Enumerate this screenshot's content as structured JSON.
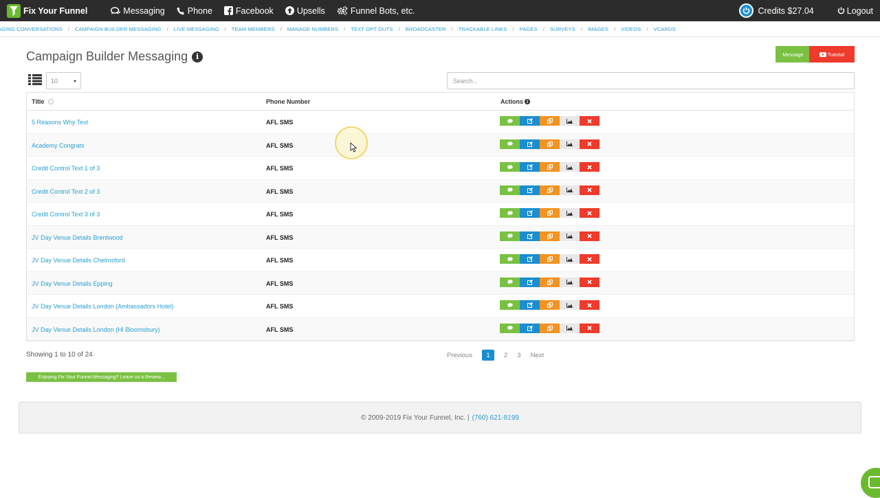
{
  "brand": {
    "name": "Fix Your Funnel"
  },
  "topnav": [
    {
      "label": "Messaging",
      "icon": "comments-icon"
    },
    {
      "label": "Phone",
      "icon": "phone-icon"
    },
    {
      "label": "Facebook",
      "icon": "facebook-icon"
    },
    {
      "label": "Upsells",
      "icon": "arrow-up-circle-icon"
    },
    {
      "label": "Funnel Bots, etc.",
      "icon": "gears-icon"
    }
  ],
  "account": {
    "credits": "Credits $27.04",
    "logout": "Logout"
  },
  "subnav": [
    "AGING CONVERSATIONS",
    "CAMPAIGN BUILDER MESSAGING",
    "LIVE MESSAGING",
    "TEAM MEMBERS",
    "MANAGE NUMBERS",
    "TEXT OPT OUTS",
    "BROADCASTER",
    "TRACKABLE LINKS",
    "PAGES",
    "SURVEYS",
    "IMAGES",
    "VIDEOS",
    "VCARDS"
  ],
  "page": {
    "title": "Campaign Builder Messaging",
    "message_button": "Message",
    "tutorial_button": "Tutorial"
  },
  "controls": {
    "page_size": "10",
    "search_placeholder": "Search..."
  },
  "table": {
    "headers": {
      "title": "Title",
      "phone": "Phone Number",
      "actions": "Actions"
    },
    "rows": [
      {
        "title": "5 Reasons Why Text",
        "phone": "AFL SMS"
      },
      {
        "title": "Academy Congrats",
        "phone": "AFL SMS"
      },
      {
        "title": "Credit Control Text 1 of 3",
        "phone": "AFL SMS"
      },
      {
        "title": "Credit Control Text 2 of 3",
        "phone": "AFL SMS"
      },
      {
        "title": "Credit Control Text 3 of 3",
        "phone": "AFL SMS"
      },
      {
        "title": "JV Day Venue Details Brentwood",
        "phone": "AFL SMS"
      },
      {
        "title": "JV Day Venue Details Chelmsford",
        "phone": "AFL SMS"
      },
      {
        "title": "JV Day Venue Details Epping",
        "phone": "AFL SMS"
      },
      {
        "title": "JV Day Venue Details London (Ambassadors Hotel)",
        "phone": "AFL SMS"
      },
      {
        "title": "JV Day Venue Details London (Hl Bloomsbury)",
        "phone": "AFL SMS"
      }
    ]
  },
  "pagination": {
    "showing": "Showing 1 to 10 of 24",
    "previous": "Previous",
    "pages": [
      "1",
      "2",
      "3"
    ],
    "next": "Next"
  },
  "review_banner": "Enjoying Fix Your Funnel Messaging? Leave us a Review...",
  "footer": {
    "copyright": "© 2009-2019 Fix Your Funnel, Inc. |",
    "phone": "(760) 621-8199"
  },
  "colors": {
    "green": "#7ac143",
    "blue": "#1a8ed0",
    "orange": "#f29322",
    "red": "#ee3b2b",
    "link": "#2a9fd0",
    "topbar": "#2c2c2c"
  }
}
